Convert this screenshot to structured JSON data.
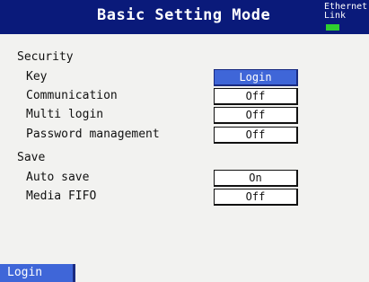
{
  "header": {
    "title": "Basic Setting Mode",
    "ethernet_label": "Ethernet",
    "link_label": "Link",
    "link_color": "#2fcf2f"
  },
  "security": {
    "heading": "Security",
    "rows": [
      {
        "label": "Key",
        "value": "Login",
        "selected": true
      },
      {
        "label": "Communication",
        "value": "Off"
      },
      {
        "label": "Multi login",
        "value": "Off"
      },
      {
        "label": "Password management",
        "value": "Off"
      }
    ]
  },
  "save": {
    "heading": "Save",
    "rows": [
      {
        "label": "Auto save",
        "value": "On"
      },
      {
        "label": "Media FIFO",
        "value": "Off"
      }
    ]
  },
  "footer": {
    "login_label": "Login"
  },
  "colors": {
    "header_bg": "#0a1a7a",
    "accent": "#3f66d8",
    "background": "#f2f2f0"
  }
}
